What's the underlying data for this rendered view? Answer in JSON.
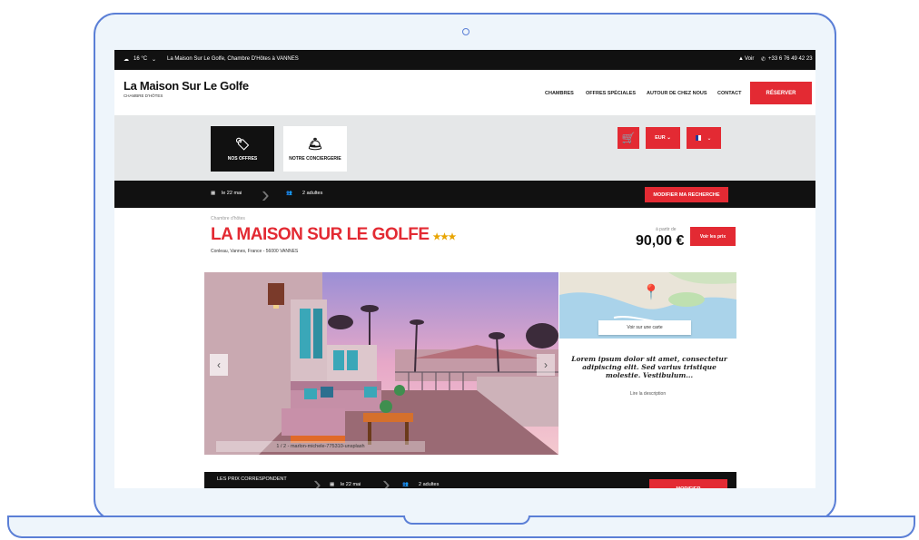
{
  "topbar": {
    "weather": "16 °C",
    "location_text": "La Maison Sur Le Golfe, Chambre D'Hôtes à VANNES",
    "view_link": "Voir",
    "phone": "+33 6 76 49 42 23"
  },
  "header": {
    "brand": "La Maison Sur Le Golfe",
    "brand_sub": "CHAMBRE D'HÔTES",
    "nav": [
      "CHAMBRES",
      "OFFRES SPÉCIALES",
      "AUTOUR DE CHEZ NOUS",
      "CONTACT"
    ],
    "reserve": "RÉSERVER"
  },
  "tiles": {
    "offers": "NOS OFFRES",
    "concierge": "NOTRE CONCIERGERIE"
  },
  "controls": {
    "currency": "EUR",
    "flag_colors": [
      "#1f3c9c",
      "#ffffff",
      "#e32a33"
    ]
  },
  "search": {
    "date": "le 22 mai",
    "guests": "2 adultes",
    "modify": "MODIFIER MA RECHERCHE"
  },
  "listing": {
    "type": "Chambre d'hôtes",
    "title": "LA MAISON SUR LE GOLFE",
    "stars": "★★★",
    "address": "Conleau, Vannes, France - 56000 VANNES",
    "from_label": "à partir de",
    "price": "90,00 €",
    "price_button": "Voir les prix"
  },
  "gallery": {
    "caption": "1 / 2 - marlon-michele-775310-unsplash"
  },
  "map": {
    "button": "Voir sur une carte"
  },
  "description": {
    "text": "Lorem ipsum dolor sit amet, consectetur adipiscing elit. Sed varius tristique molestie. Vestibulum...",
    "link": "Lire la description"
  },
  "sticky": {
    "prices_line1": "LES PRIX CORRESPONDENT",
    "date": "le 22 mai",
    "guests": "2 adultes",
    "modify": "MODIFIER"
  },
  "colors": {
    "accent": "#e32a33",
    "dark": "#111111",
    "frame": "#5b7fd6"
  }
}
